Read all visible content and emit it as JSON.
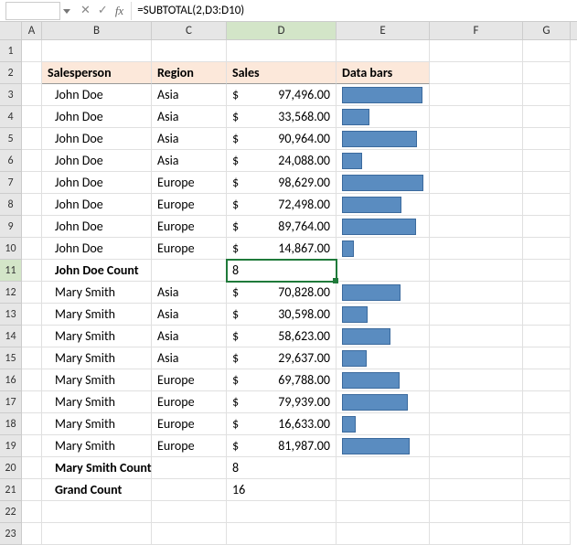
{
  "formula_bar": {
    "name_box": "",
    "formula": "=SUBTOTAL(2,D3:D10)"
  },
  "columns": [
    "A",
    "B",
    "C",
    "D",
    "E",
    "F",
    "G"
  ],
  "active_col": "D",
  "active_row": 11,
  "headers": {
    "salesperson": "Salesperson",
    "region": "Region",
    "sales": "Sales",
    "databars": "Data bars"
  },
  "rows": [
    {
      "sp": "John Doe",
      "rg": "Asia",
      "amt": "97,496.00",
      "pct": 98.8
    },
    {
      "sp": "John Doe",
      "rg": "Asia",
      "amt": "33,568.00",
      "pct": 34.0
    },
    {
      "sp": "John Doe",
      "rg": "Asia",
      "amt": "90,964.00",
      "pct": 92.2
    },
    {
      "sp": "John Doe",
      "rg": "Asia",
      "amt": "24,088.00",
      "pct": 24.4
    },
    {
      "sp": "John Doe",
      "rg": "Europe",
      "amt": "98,629.00",
      "pct": 100
    },
    {
      "sp": "John Doe",
      "rg": "Europe",
      "amt": "72,498.00",
      "pct": 73.5
    },
    {
      "sp": "John Doe",
      "rg": "Europe",
      "amt": "89,764.00",
      "pct": 91.0
    },
    {
      "sp": "John Doe",
      "rg": "Europe",
      "amt": "14,867.00",
      "pct": 15.1
    },
    {
      "subtotal": true,
      "label": "John Doe Count",
      "val": "8"
    },
    {
      "sp": "Mary Smith",
      "rg": "Asia",
      "amt": "70,828.00",
      "pct": 71.8
    },
    {
      "sp": "Mary Smith",
      "rg": "Asia",
      "amt": "30,598.00",
      "pct": 31.0
    },
    {
      "sp": "Mary Smith",
      "rg": "Asia",
      "amt": "58,623.00",
      "pct": 59.4
    },
    {
      "sp": "Mary Smith",
      "rg": "Asia",
      "amt": "29,637.00",
      "pct": 30.0
    },
    {
      "sp": "Mary Smith",
      "rg": "Europe",
      "amt": "69,788.00",
      "pct": 70.8
    },
    {
      "sp": "Mary Smith",
      "rg": "Europe",
      "amt": "79,939.00",
      "pct": 81.1
    },
    {
      "sp": "Mary Smith",
      "rg": "Europe",
      "amt": "16,633.00",
      "pct": 16.9
    },
    {
      "sp": "Mary Smith",
      "rg": "Europe",
      "amt": "81,987.00",
      "pct": 83.1
    },
    {
      "subtotal": true,
      "label": "Mary Smith Count",
      "val": "8"
    },
    {
      "subtotal": true,
      "label": "Grand Count",
      "val": "16"
    }
  ],
  "chart_data": {
    "type": "bar",
    "title": "Data bars",
    "categories": [
      "John Doe Asia",
      "John Doe Asia",
      "John Doe Asia",
      "John Doe Asia",
      "John Doe Europe",
      "John Doe Europe",
      "John Doe Europe",
      "John Doe Europe",
      "Mary Smith Asia",
      "Mary Smith Asia",
      "Mary Smith Asia",
      "Mary Smith Asia",
      "Mary Smith Europe",
      "Mary Smith Europe",
      "Mary Smith Europe",
      "Mary Smith Europe"
    ],
    "values": [
      97496,
      33568,
      90964,
      24088,
      98629,
      72498,
      89764,
      14867,
      70828,
      30598,
      58623,
      29637,
      69788,
      79939,
      16633,
      81987
    ],
    "xlabel": "Sales",
    "ylabel": "",
    "ylim": [
      0,
      98629
    ]
  }
}
